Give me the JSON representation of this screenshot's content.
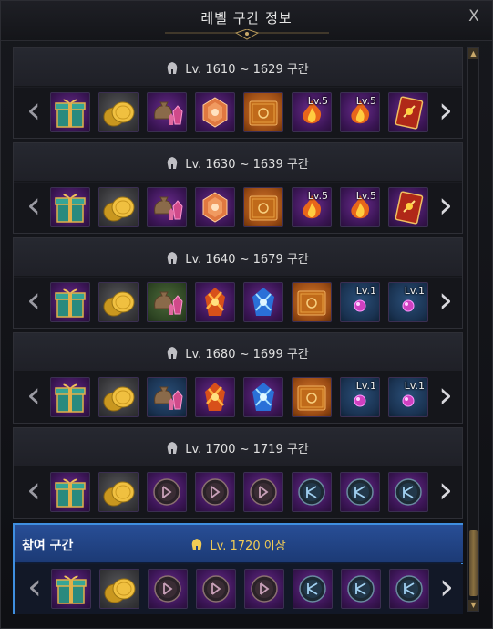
{
  "window": {
    "title": "레벨 구간 정보",
    "close_icon": "X"
  },
  "colors": {
    "accent": "#3f8fe0",
    "active_text": "#f2cc55",
    "slot_border": "#3b2f52"
  },
  "sections": [
    {
      "range": "Lv. 1610 ~ 1629 구간",
      "active": false,
      "items": [
        {
          "icon": "gift-box-icon",
          "bg": "purple"
        },
        {
          "icon": "gold-coins-icon",
          "bg": "gray"
        },
        {
          "icon": "pouch-crystals-icon",
          "bg": "purple"
        },
        {
          "icon": "orange-gem-icon",
          "bg": "purple"
        },
        {
          "icon": "orange-book-icon",
          "bg": "orange"
        },
        {
          "icon": "fire-rune-icon",
          "bg": "purple",
          "level": "Lv.5"
        },
        {
          "icon": "fire-rune-icon",
          "bg": "purple",
          "level": "Lv.5"
        },
        {
          "icon": "red-card-icon",
          "bg": "purple"
        }
      ]
    },
    {
      "range": "Lv. 1630 ~ 1639 구간",
      "active": false,
      "items": [
        {
          "icon": "gift-box-icon",
          "bg": "purple"
        },
        {
          "icon": "gold-coins-icon",
          "bg": "gray"
        },
        {
          "icon": "pouch-crystals-icon",
          "bg": "purple"
        },
        {
          "icon": "orange-gem-icon",
          "bg": "purple"
        },
        {
          "icon": "orange-book-icon",
          "bg": "orange"
        },
        {
          "icon": "fire-rune-icon",
          "bg": "purple",
          "level": "Lv.5"
        },
        {
          "icon": "fire-rune-icon",
          "bg": "purple",
          "level": "Lv.5"
        },
        {
          "icon": "red-card-icon",
          "bg": "purple"
        }
      ]
    },
    {
      "range": "Lv. 1640 ~ 1679 구간",
      "active": false,
      "items": [
        {
          "icon": "gift-box-icon",
          "bg": "purple"
        },
        {
          "icon": "gold-coins-icon",
          "bg": "gray"
        },
        {
          "icon": "pouch-crystals-icon",
          "bg": "green"
        },
        {
          "icon": "fire-crystal-icon",
          "bg": "purple"
        },
        {
          "icon": "ice-crystal-icon",
          "bg": "purple"
        },
        {
          "icon": "orange-book-icon",
          "bg": "orange"
        },
        {
          "icon": "magenta-gem-icon",
          "bg": "blue",
          "level": "Lv.1"
        },
        {
          "icon": "magenta-gem-icon",
          "bg": "blue",
          "level": "Lv.1"
        }
      ]
    },
    {
      "range": "Lv. 1680 ~ 1699 구간",
      "active": false,
      "items": [
        {
          "icon": "gift-box-icon",
          "bg": "purple"
        },
        {
          "icon": "gold-coins-icon",
          "bg": "gray"
        },
        {
          "icon": "pouch-crystals-icon",
          "bg": "blue"
        },
        {
          "icon": "fire-crystal-icon",
          "bg": "purple"
        },
        {
          "icon": "ice-crystal-icon",
          "bg": "purple"
        },
        {
          "icon": "orange-book-icon",
          "bg": "orange"
        },
        {
          "icon": "magenta-gem-icon",
          "bg": "blue",
          "level": "Lv.1"
        },
        {
          "icon": "magenta-gem-icon",
          "bg": "blue",
          "level": "Lv.1"
        }
      ]
    },
    {
      "range": "Lv. 1700 ~ 1719 구간",
      "active": false,
      "items": [
        {
          "icon": "gift-box-icon",
          "bg": "purple"
        },
        {
          "icon": "gold-coins-icon",
          "bg": "gray"
        },
        {
          "icon": "rune-stone-icon",
          "bg": "purple"
        },
        {
          "icon": "rune-stone-icon",
          "bg": "purple"
        },
        {
          "icon": "rune-stone-icon",
          "bg": "purple"
        },
        {
          "icon": "blue-rune-stone-icon",
          "bg": "purple"
        },
        {
          "icon": "blue-rune-stone-icon",
          "bg": "purple"
        },
        {
          "icon": "blue-rune-stone-icon",
          "bg": "purple"
        }
      ]
    },
    {
      "range": "Lv. 1720 이상",
      "active": true,
      "active_label": "참여 구간",
      "items": [
        {
          "icon": "gift-box-icon",
          "bg": "purple"
        },
        {
          "icon": "gold-coins-icon",
          "bg": "gray"
        },
        {
          "icon": "rune-stone-icon",
          "bg": "purple"
        },
        {
          "icon": "rune-stone-icon",
          "bg": "purple"
        },
        {
          "icon": "rune-stone-icon",
          "bg": "purple"
        },
        {
          "icon": "blue-rune-stone-icon",
          "bg": "purple"
        },
        {
          "icon": "blue-rune-stone-icon",
          "bg": "purple"
        },
        {
          "icon": "blue-rune-stone-icon",
          "bg": "purple"
        }
      ]
    }
  ]
}
